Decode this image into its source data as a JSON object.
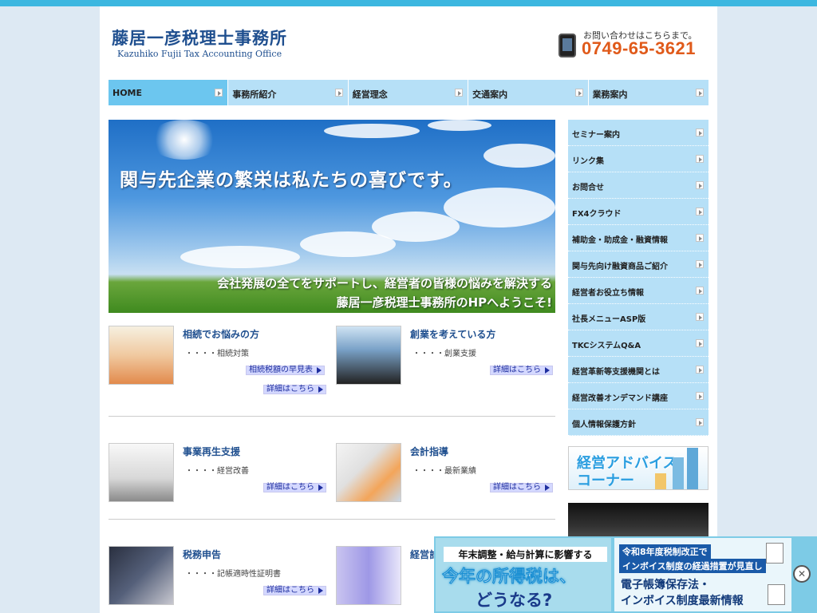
{
  "header": {
    "logo_jp": "藤居一彦税理士事務所",
    "logo_en": "Kazuhiko Fujii Tax Accounting Office",
    "contact_label": "お問い合わせはこちらまで。",
    "phone": "0749-65-3621"
  },
  "nav": [
    {
      "label": "HOME"
    },
    {
      "label": "事務所紹介"
    },
    {
      "label": "経営理念"
    },
    {
      "label": "交通案内"
    },
    {
      "label": "業務案内"
    }
  ],
  "hero": {
    "headline": "関与先企業の繁栄は私たちの喜びです。",
    "sub1": "会社発展の全てをサポートし、経営者の皆様の悩みを解決する",
    "sub2": "藤居一彦税理士事務所のHPへようこそ!"
  },
  "cards": [
    {
      "title": "相続でお悩みの方",
      "desc": "・・・・相続対策",
      "extra_link": "相続税額の早見表",
      "link": "詳細はこちら"
    },
    {
      "title": "創業を考えている方",
      "desc": "・・・・創業支援",
      "link": "詳細はこちら"
    },
    {
      "title": "事業再生支援",
      "desc": "・・・・経営改善",
      "link": "詳細はこちら"
    },
    {
      "title": "会計指導",
      "desc": "・・・・最新業績",
      "link": "詳細はこちら"
    },
    {
      "title": "税務申告",
      "desc": "・・・・記帳適時性証明書",
      "link": "詳細はこちら"
    },
    {
      "title": "経営計"
    }
  ],
  "sidebar": [
    {
      "label": "セミナー案内"
    },
    {
      "label": "リンク集"
    },
    {
      "label": "お問合せ"
    },
    {
      "label": "FX4クラウド"
    },
    {
      "label": "補助金・助成金・融資情報"
    },
    {
      "label": "関与先向け融資商品ご紹介"
    },
    {
      "label": "経営者お役立ち情報"
    },
    {
      "label": "社長メニューASP版"
    },
    {
      "label": "TKCシステムQ&A"
    },
    {
      "label": "経営革新等支援機関とは"
    },
    {
      "label": "経営改善オンデマンド講座"
    },
    {
      "label": "個人情報保護方針"
    }
  ],
  "advice": {
    "line1": "経営アドバイス",
    "line2": "コーナー"
  },
  "banner": {
    "left_top": "年末調整・給与計算に影響する",
    "left_main": "今年の所得税は、",
    "left_bottom": "どうなる?",
    "right_tag1": "令和8年度税制改正で",
    "right_tag2": "インボイス制度の経過措置が見直し",
    "right_line1": "電子帳簿保存法・",
    "right_line2": "インボイス制度最新情報",
    "close": "✕"
  },
  "colors": {
    "accent": "#3cb7e0",
    "nav_bg": "#b6e0f7",
    "nav_active": "#6cc6ef",
    "title_blue": "#1f4f8f",
    "phone_orange": "#e05a1a"
  }
}
